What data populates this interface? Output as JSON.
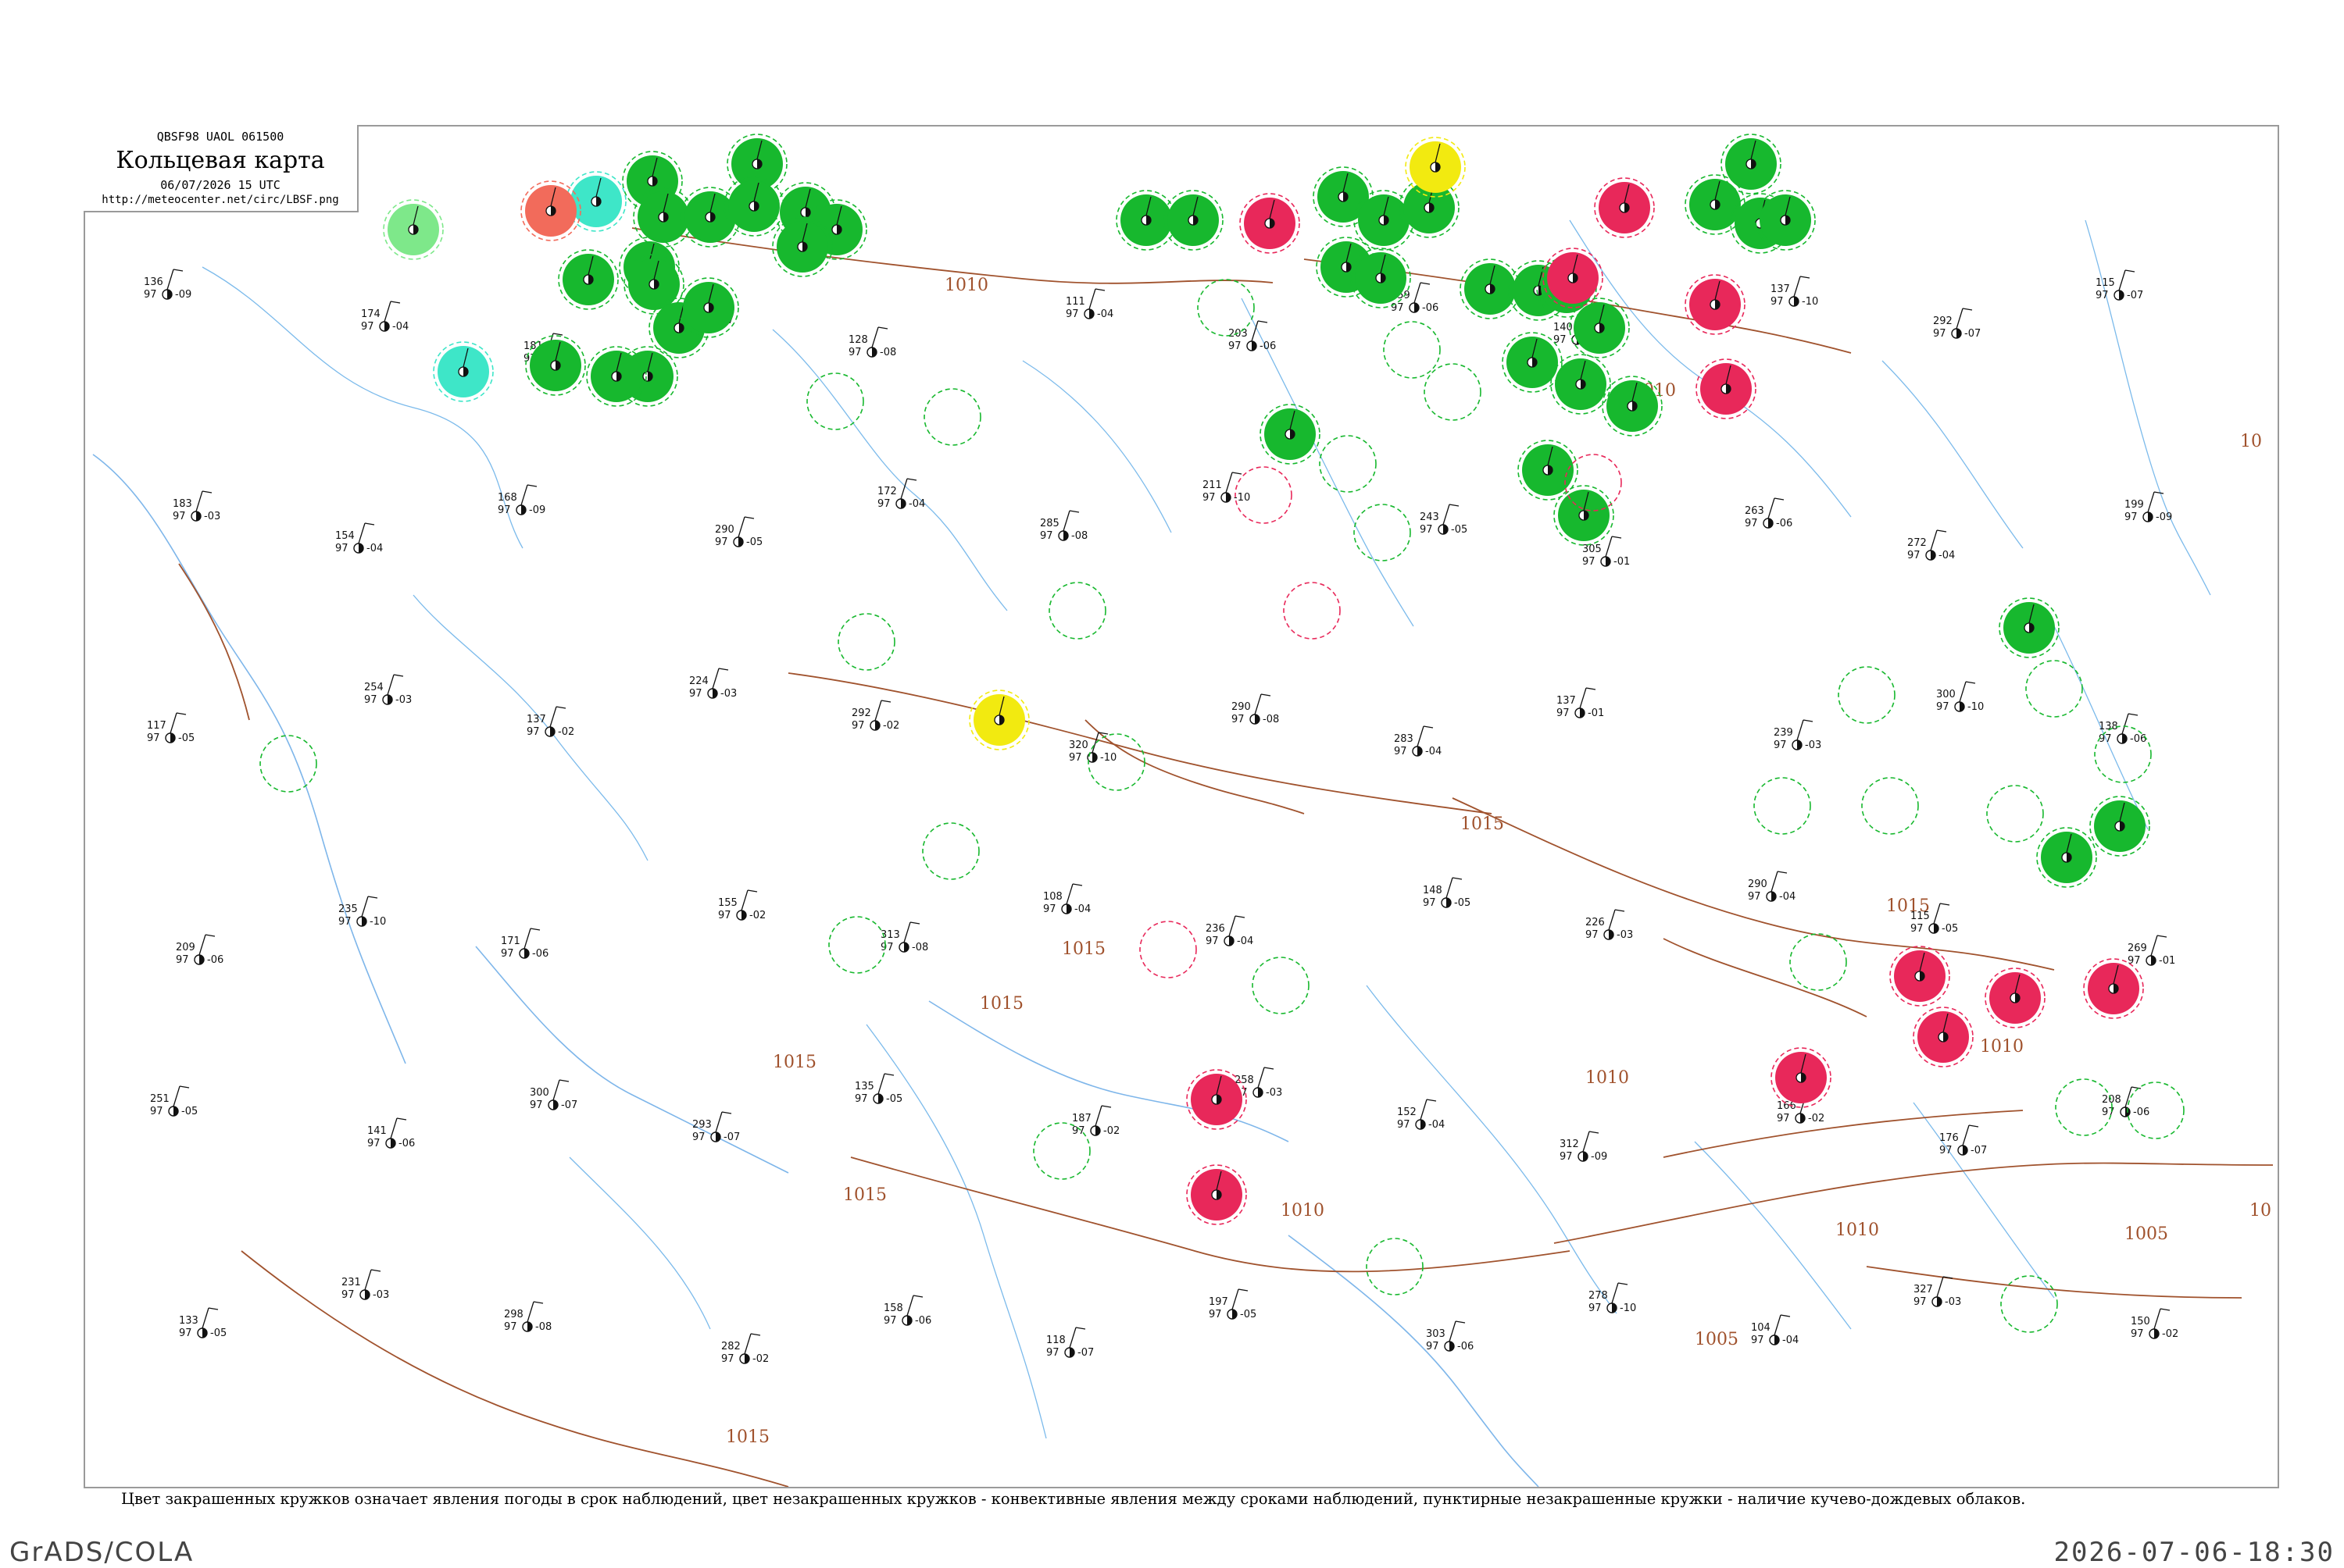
{
  "header": {
    "product_code": "QBSF98  UAOL  061500",
    "title": "Кольцевая карта",
    "datetime": "06/07/2026 15 UTC",
    "url": "http://meteocenter.net/circ/LBSF.png"
  },
  "legend_text": "Цвет закрашенных кружков означает явления погоды в срок наблюдений, цвет незакрашенных кружков - конвективные явления между сроками наблюдений, пунктирные незакрашенные кружки - наличие кучево-дождевых облаков.",
  "footer": {
    "left": "GrADS/COLA",
    "right": "2026-07-06-18:30"
  },
  "colors": {
    "green": "#17b82e",
    "red": "#e8285a",
    "yellow": "#f2ea10",
    "cyan": "#3ee6c8",
    "light_green": "#7ee88a",
    "salmon": "#f26b5b",
    "isobar": "#a0522d",
    "river": "#5aa9e6"
  },
  "isobar_labels": [
    "1010",
    "1010",
    "1015",
    "1015",
    "1015",
    "1015",
    "1015",
    "1015",
    "1010",
    "1010",
    "1010",
    "1010",
    "1005",
    "1005",
    "1015",
    "10",
    "10"
  ],
  "markers": [
    {
      "kind": "green"
    },
    {
      "kind": "green"
    },
    {
      "kind": "green"
    },
    {
      "kind": "green"
    },
    {
      "kind": "green"
    },
    {
      "kind": "green"
    },
    {
      "kind": "green"
    },
    {
      "kind": "green"
    },
    {
      "kind": "green"
    },
    {
      "kind": "green"
    },
    {
      "kind": "green"
    },
    {
      "kind": "green"
    },
    {
      "kind": "green"
    },
    {
      "kind": "green"
    },
    {
      "kind": "green"
    },
    {
      "kind": "green"
    },
    {
      "kind": "green"
    },
    {
      "kind": "green"
    },
    {
      "kind": "green"
    },
    {
      "kind": "green"
    },
    {
      "kind": "green"
    },
    {
      "kind": "green"
    },
    {
      "kind": "green"
    },
    {
      "kind": "green"
    },
    {
      "kind": "green"
    },
    {
      "kind": "green"
    },
    {
      "kind": "green"
    },
    {
      "kind": "green"
    },
    {
      "kind": "green"
    },
    {
      "kind": "green"
    },
    {
      "kind": "green"
    },
    {
      "kind": "green"
    },
    {
      "kind": "green"
    },
    {
      "kind": "green"
    },
    {
      "kind": "green"
    },
    {
      "kind": "green"
    },
    {
      "kind": "green"
    },
    {
      "kind": "green"
    },
    {
      "kind": "green"
    },
    {
      "kind": "green"
    },
    {
      "kind": "red"
    },
    {
      "kind": "red"
    },
    {
      "kind": "red"
    },
    {
      "kind": "red"
    },
    {
      "kind": "red"
    },
    {
      "kind": "red"
    },
    {
      "kind": "red"
    },
    {
      "kind": "red"
    },
    {
      "kind": "red"
    },
    {
      "kind": "red"
    },
    {
      "kind": "red"
    },
    {
      "kind": "red"
    },
    {
      "kind": "yellow"
    },
    {
      "kind": "yellow"
    },
    {
      "kind": "cyan"
    },
    {
      "kind": "cyan"
    },
    {
      "kind": "light_green"
    },
    {
      "kind": "salmon"
    }
  ],
  "stations": [
    {
      "temp": "136",
      "dew": "97",
      "press": "-09"
    },
    {
      "temp": "174",
      "dew": "97",
      "press": "-04"
    },
    {
      "temp": "181",
      "dew": "97",
      "press": "-05"
    },
    {
      "temp": "156",
      "dew": "97",
      "press": "-07"
    },
    {
      "temp": "128",
      "dew": "97",
      "press": "-08"
    },
    {
      "temp": "111",
      "dew": "97",
      "press": "-04"
    },
    {
      "temp": "203",
      "dew": "97",
      "press": "-06"
    },
    {
      "temp": "159",
      "dew": "97",
      "press": "-06"
    },
    {
      "temp": "140",
      "dew": "97",
      "press": "-06"
    },
    {
      "temp": "137",
      "dew": "97",
      "press": "-10"
    },
    {
      "temp": "292",
      "dew": "97",
      "press": "-07"
    },
    {
      "temp": "115",
      "dew": "97",
      "press": "-07"
    },
    {
      "temp": "183",
      "dew": "97",
      "press": "-03"
    },
    {
      "temp": "154",
      "dew": "97",
      "press": "-04"
    },
    {
      "temp": "168",
      "dew": "97",
      "press": "-09"
    },
    {
      "temp": "290",
      "dew": "97",
      "press": "-05"
    },
    {
      "temp": "172",
      "dew": "97",
      "press": "-04"
    },
    {
      "temp": "285",
      "dew": "97",
      "press": "-08"
    },
    {
      "temp": "211",
      "dew": "97",
      "press": "-10"
    },
    {
      "temp": "243",
      "dew": "97",
      "press": "-05"
    },
    {
      "temp": "305",
      "dew": "97",
      "press": "-01"
    },
    {
      "temp": "263",
      "dew": "97",
      "press": "-06"
    },
    {
      "temp": "272",
      "dew": "97",
      "press": "-04"
    },
    {
      "temp": "199",
      "dew": "97",
      "press": "-09"
    },
    {
      "temp": "117",
      "dew": "97",
      "press": "-05"
    },
    {
      "temp": "254",
      "dew": "97",
      "press": "-03"
    },
    {
      "temp": "137",
      "dew": "97",
      "press": "-02"
    },
    {
      "temp": "224",
      "dew": "97",
      "press": "-03"
    },
    {
      "temp": "292",
      "dew": "97",
      "press": "-02"
    },
    {
      "temp": "320",
      "dew": "97",
      "press": "-10"
    },
    {
      "temp": "290",
      "dew": "97",
      "press": "-08"
    },
    {
      "temp": "283",
      "dew": "97",
      "press": "-04"
    },
    {
      "temp": "137",
      "dew": "97",
      "press": "-01"
    },
    {
      "temp": "239",
      "dew": "97",
      "press": "-03"
    },
    {
      "temp": "300",
      "dew": "97",
      "press": "-10"
    },
    {
      "temp": "138",
      "dew": "97",
      "press": "-06"
    },
    {
      "temp": "209",
      "dew": "97",
      "press": "-06"
    },
    {
      "temp": "235",
      "dew": "97",
      "press": "-10"
    },
    {
      "temp": "171",
      "dew": "97",
      "press": "-06"
    },
    {
      "temp": "155",
      "dew": "97",
      "press": "-02"
    },
    {
      "temp": "313",
      "dew": "97",
      "press": "-08"
    },
    {
      "temp": "108",
      "dew": "97",
      "press": "-04"
    },
    {
      "temp": "236",
      "dew": "97",
      "press": "-04"
    },
    {
      "temp": "148",
      "dew": "97",
      "press": "-05"
    },
    {
      "temp": "226",
      "dew": "97",
      "press": "-03"
    },
    {
      "temp": "290",
      "dew": "97",
      "press": "-04"
    },
    {
      "temp": "115",
      "dew": "97",
      "press": "-05"
    },
    {
      "temp": "269",
      "dew": "97",
      "press": "-01"
    },
    {
      "temp": "251",
      "dew": "97",
      "press": "-05"
    },
    {
      "temp": "141",
      "dew": "97",
      "press": "-06"
    },
    {
      "temp": "300",
      "dew": "97",
      "press": "-07"
    },
    {
      "temp": "293",
      "dew": "97",
      "press": "-07"
    },
    {
      "temp": "135",
      "dew": "97",
      "press": "-05"
    },
    {
      "temp": "187",
      "dew": "97",
      "press": "-02"
    },
    {
      "temp": "258",
      "dew": "97",
      "press": "-03"
    },
    {
      "temp": "152",
      "dew": "97",
      "press": "-04"
    },
    {
      "temp": "312",
      "dew": "97",
      "press": "-09"
    },
    {
      "temp": "166",
      "dew": "97",
      "press": "-02"
    },
    {
      "temp": "176",
      "dew": "97",
      "press": "-07"
    },
    {
      "temp": "208",
      "dew": "97",
      "press": "-06"
    },
    {
      "temp": "133",
      "dew": "97",
      "press": "-05"
    },
    {
      "temp": "231",
      "dew": "97",
      "press": "-03"
    },
    {
      "temp": "298",
      "dew": "97",
      "press": "-08"
    },
    {
      "temp": "282",
      "dew": "97",
      "press": "-02"
    },
    {
      "temp": "158",
      "dew": "97",
      "press": "-06"
    },
    {
      "temp": "118",
      "dew": "97",
      "press": "-07"
    },
    {
      "temp": "197",
      "dew": "97",
      "press": "-05"
    },
    {
      "temp": "303",
      "dew": "97",
      "press": "-06"
    },
    {
      "temp": "278",
      "dew": "97",
      "press": "-10"
    },
    {
      "temp": "104",
      "dew": "97",
      "press": "-04"
    },
    {
      "temp": "327",
      "dew": "97",
      "press": "-03"
    },
    {
      "temp": "150",
      "dew": "97",
      "press": "-02"
    }
  ]
}
